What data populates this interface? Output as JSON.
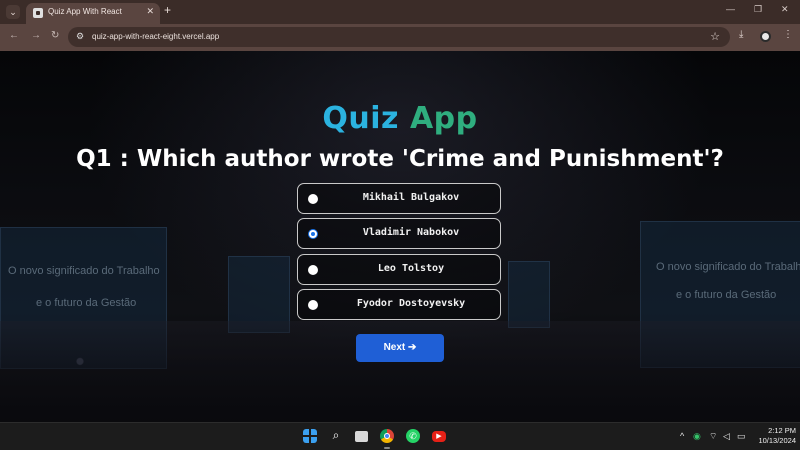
{
  "browser": {
    "tab_title": "Quiz App With React",
    "url": "quiz-app-with-react-eight.vercel.app",
    "new_tab_symbol": "+",
    "close_symbol": "✕"
  },
  "background": {
    "left_screen_line1": "O novo significado do Trabalho",
    "left_screen_line2": "e o futuro da Gestão",
    "right_screen_line1": "O novo significado do Trabalho",
    "right_screen_line2": "e o futuro da Gestão"
  },
  "quiz": {
    "title_part1": "Quiz",
    "title_part2": "App",
    "question": "Q1 : Which author wrote 'Crime and Punishment'?",
    "options": [
      {
        "label": "Mikhail Bulgakov",
        "selected": false
      },
      {
        "label": "Vladimir Nabokov",
        "selected": true
      },
      {
        "label": "Leo Tolstoy",
        "selected": false
      },
      {
        "label": "Fyodor Dostoyevsky",
        "selected": false
      }
    ],
    "next_label": "Next ➔"
  },
  "taskbar": {
    "time": "2:12 PM",
    "date": "10/13/2024",
    "apps": [
      "windows-start-icon",
      "search-icon",
      "task-view-icon",
      "chrome-icon",
      "whatsapp-icon",
      "youtube-icon"
    ]
  },
  "colors": {
    "title_blue": "#2bb3e0",
    "title_green": "#2fae7f",
    "next_button": "#1f5fd6",
    "radio_selected": "#1a73e8"
  }
}
